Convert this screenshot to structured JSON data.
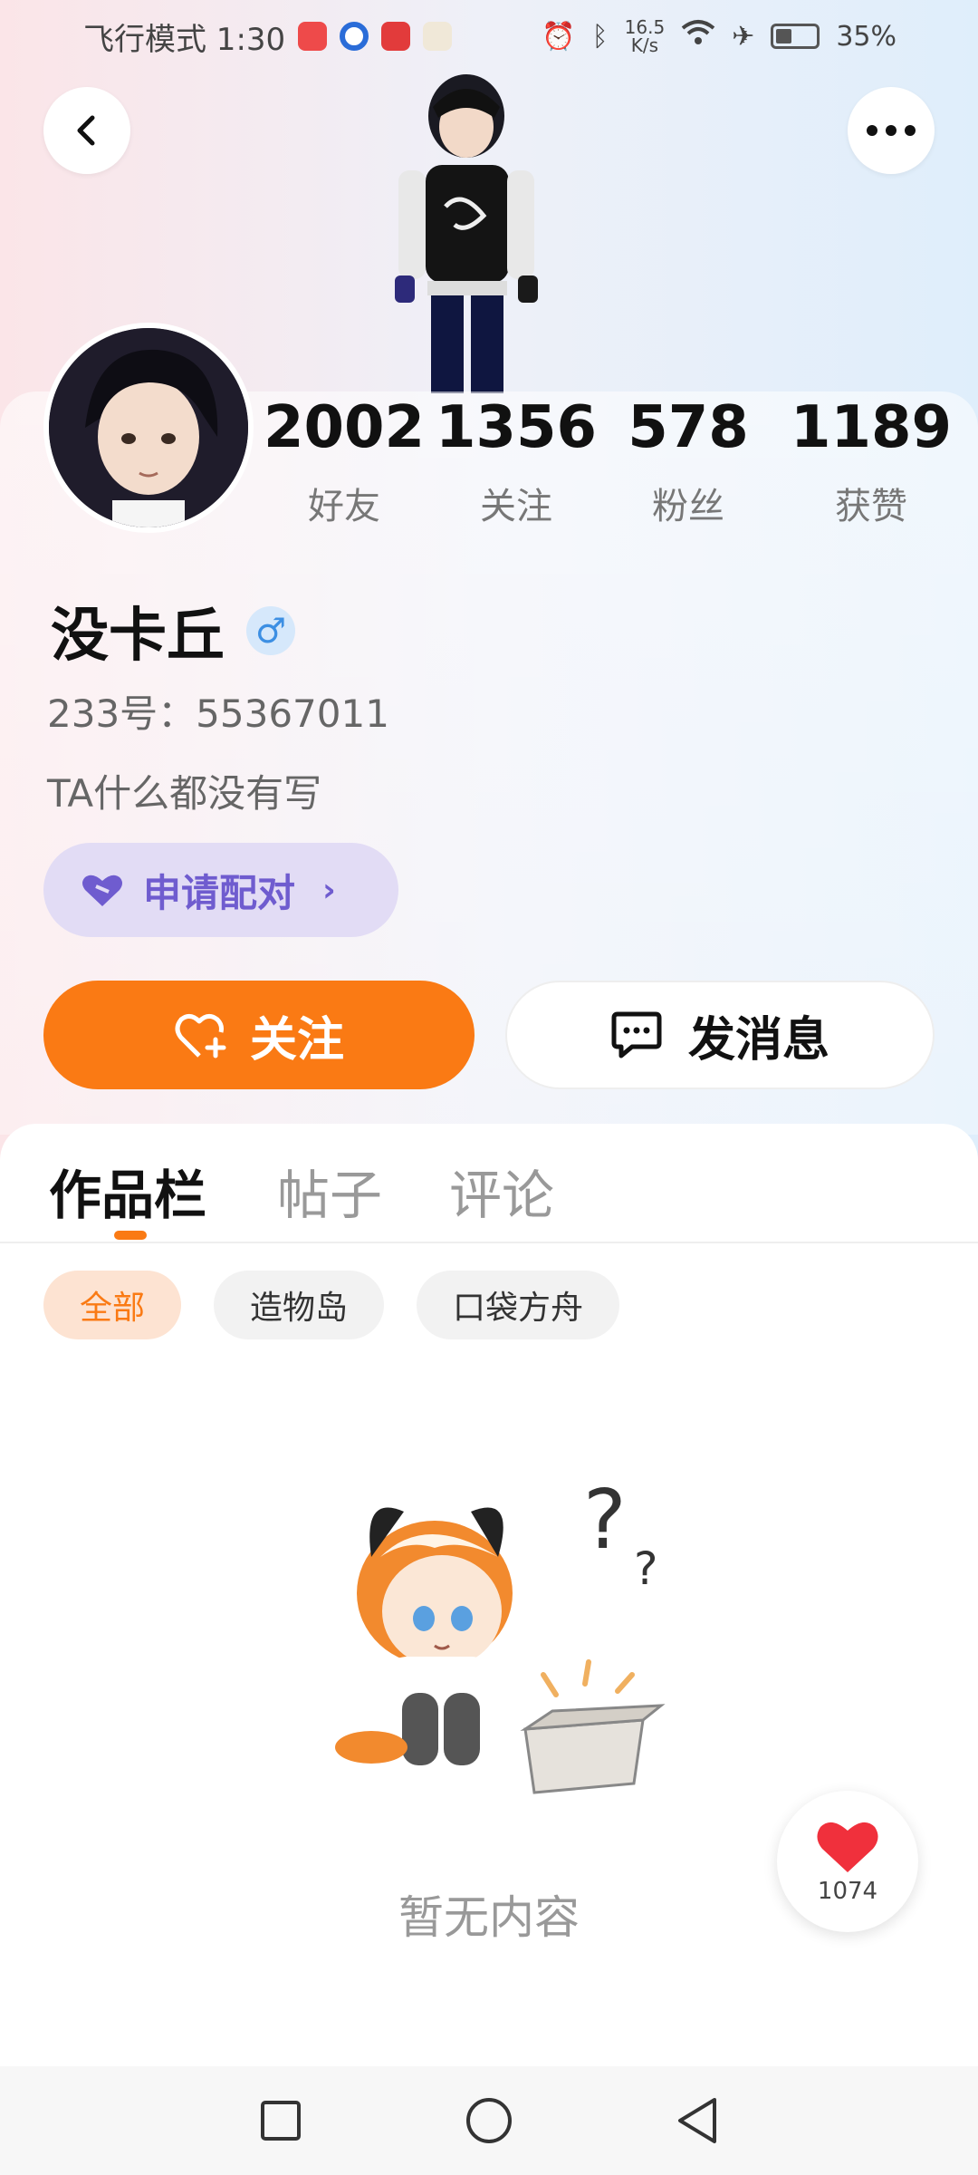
{
  "status_bar": {
    "left_text": "飞行模式 1:30",
    "speed_value": "16.5",
    "speed_unit": "K/s",
    "battery": "35%",
    "battery_level": 0.35
  },
  "icons": {
    "back": "chevron-left-icon",
    "more": "more-dots-icon",
    "gender": "male-icon",
    "pair": "heart-link-icon",
    "follow": "heart-plus-icon",
    "message": "chat-bubble-icon",
    "like": "heart-icon"
  },
  "stats": [
    {
      "value": "2002",
      "label": "好友"
    },
    {
      "value": "1356",
      "label": "关注"
    },
    {
      "value": "578",
      "label": "粉丝"
    },
    {
      "value": "1189",
      "label": "获赞"
    }
  ],
  "profile": {
    "name": "没卡丘",
    "gender_symbol": "♂",
    "uid": "233号：55367011",
    "bio": "TA什么都没有写"
  },
  "buttons": {
    "pair": "申请配对",
    "pair_chevron": "›",
    "follow": "关注",
    "message": "发消息"
  },
  "tabs": [
    "作品栏",
    "帖子",
    "评论"
  ],
  "chips": [
    "全部",
    "造物岛",
    "口袋方舟"
  ],
  "empty": {
    "text": "暂无内容"
  },
  "like": {
    "count": "1074"
  },
  "colors": {
    "accent": "#fa7a14",
    "pair_bg": "#e2dcf5",
    "pair_text": "#6f5ccf",
    "gender": "#3d8fe3",
    "like": "#f0303c"
  }
}
